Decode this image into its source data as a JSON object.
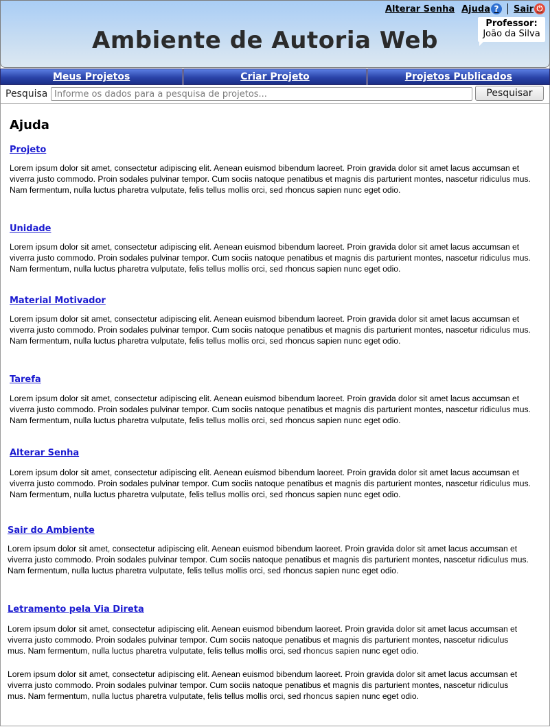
{
  "header": {
    "app_title": "Ambiente de Autoria Web",
    "links": {
      "change_password": "Alterar Senha",
      "help": "Ajuda",
      "logout": "Sair"
    },
    "user_role": "Professor:",
    "user_name": "João da Silva"
  },
  "nav": {
    "tabs": [
      "Meus Projetos",
      "Criar Projeto",
      "Projetos Publicados"
    ]
  },
  "search": {
    "label": "Pesquisa",
    "placeholder": "Informe os dados para a pesquisa de projetos...",
    "button": "Pesquisar"
  },
  "page_title": "Ajuda",
  "sections": [
    {
      "title": "Projeto",
      "text": "Lorem ipsum dolor sit amet, consectetur adipiscing elit. Aenean euismod bibendum laoreet. Proin gravida dolor sit amet lacus accumsan et viverra justo commodo. Proin sodales pulvinar tempor. Cum sociis natoque penatibus et magnis dis parturient montes, nascetur ridiculus mus. Nam fermentum, nulla luctus pharetra vulputate, felis tellus mollis orci, sed rhoncus sapien nunc eget odio."
    },
    {
      "title": "Unidade",
      "text": "Lorem ipsum dolor sit amet, consectetur adipiscing elit. Aenean euismod bibendum laoreet. Proin gravida dolor sit amet lacus accumsan et viverra justo commodo. Proin sodales pulvinar tempor. Cum sociis natoque penatibus et magnis dis parturient montes, nascetur ridiculus mus. Nam fermentum, nulla luctus pharetra vulputate, felis tellus mollis orci, sed rhoncus sapien nunc eget odio."
    },
    {
      "title": "Material Motivador",
      "text": "Lorem ipsum dolor sit amet, consectetur adipiscing elit. Aenean euismod bibendum laoreet. Proin gravida dolor sit amet lacus accumsan et viverra justo commodo. Proin sodales pulvinar tempor. Cum sociis natoque penatibus et magnis dis parturient montes, nascetur ridiculus mus. Nam fermentum, nulla luctus pharetra vulputate, felis tellus mollis orci, sed rhoncus sapien nunc eget odio."
    },
    {
      "title": "Tarefa",
      "text": "Lorem ipsum dolor sit amet, consectetur adipiscing elit. Aenean euismod bibendum laoreet. Proin gravida dolor sit amet lacus accumsan et viverra justo commodo. Proin sodales pulvinar tempor. Cum sociis natoque penatibus et magnis dis parturient montes, nascetur ridiculus mus. Nam fermentum, nulla luctus pharetra vulputate, felis tellus mollis orci, sed rhoncus sapien nunc eget odio."
    },
    {
      "title": "Alterar Senha",
      "text": "Lorem ipsum dolor sit amet, consectetur adipiscing elit. Aenean euismod bibendum laoreet. Proin gravida dolor sit amet lacus accumsan et viverra justo commodo. Proin sodales pulvinar tempor. Cum sociis natoque penatibus et magnis dis parturient montes, nascetur ridiculus mus. Nam fermentum, nulla luctus pharetra vulputate, felis tellus mollis orci, sed rhoncus sapien nunc eget odio."
    },
    {
      "title": "Sair do Ambiente",
      "text": "Lorem ipsum dolor sit amet, consectetur adipiscing elit. Aenean euismod bibendum laoreet. Proin gravida dolor sit amet lacus accumsan et viverra justo commodo. Proin sodales pulvinar tempor. Cum sociis natoque penatibus et magnis dis parturient montes, nascetur ridiculus mus. Nam fermentum, nulla luctus pharetra vulputate, felis tellus mollis orci, sed rhoncus sapien nunc eget odio."
    },
    {
      "title": "Letramento pela Via Direta",
      "text": "Lorem ipsum dolor sit amet, consectetur adipiscing elit. Aenean euismod bibendum laoreet. Proin gravida dolor sit amet lacus accumsan et viverra justo commodo. Proin sodales pulvinar tempor. Cum sociis natoque penatibus et magnis dis parturient montes, nascetur ridiculus mus. Nam fermentum, nulla luctus pharetra vulputate, felis tellus mollis orci, sed rhoncus sapien nunc eget odio.",
      "text2": "Lorem ipsum dolor sit amet, consectetur adipiscing elit. Aenean euismod bibendum laoreet. Proin gravida dolor sit amet lacus accumsan et viverra justo commodo. Proin sodales pulvinar tempor. Cum sociis natoque penatibus et magnis dis parturient montes, nascetur ridiculus mus. Nam fermentum, nulla luctus pharetra vulputate, felis tellus mollis orci, sed rhoncus sapien nunc eget odio."
    }
  ]
}
